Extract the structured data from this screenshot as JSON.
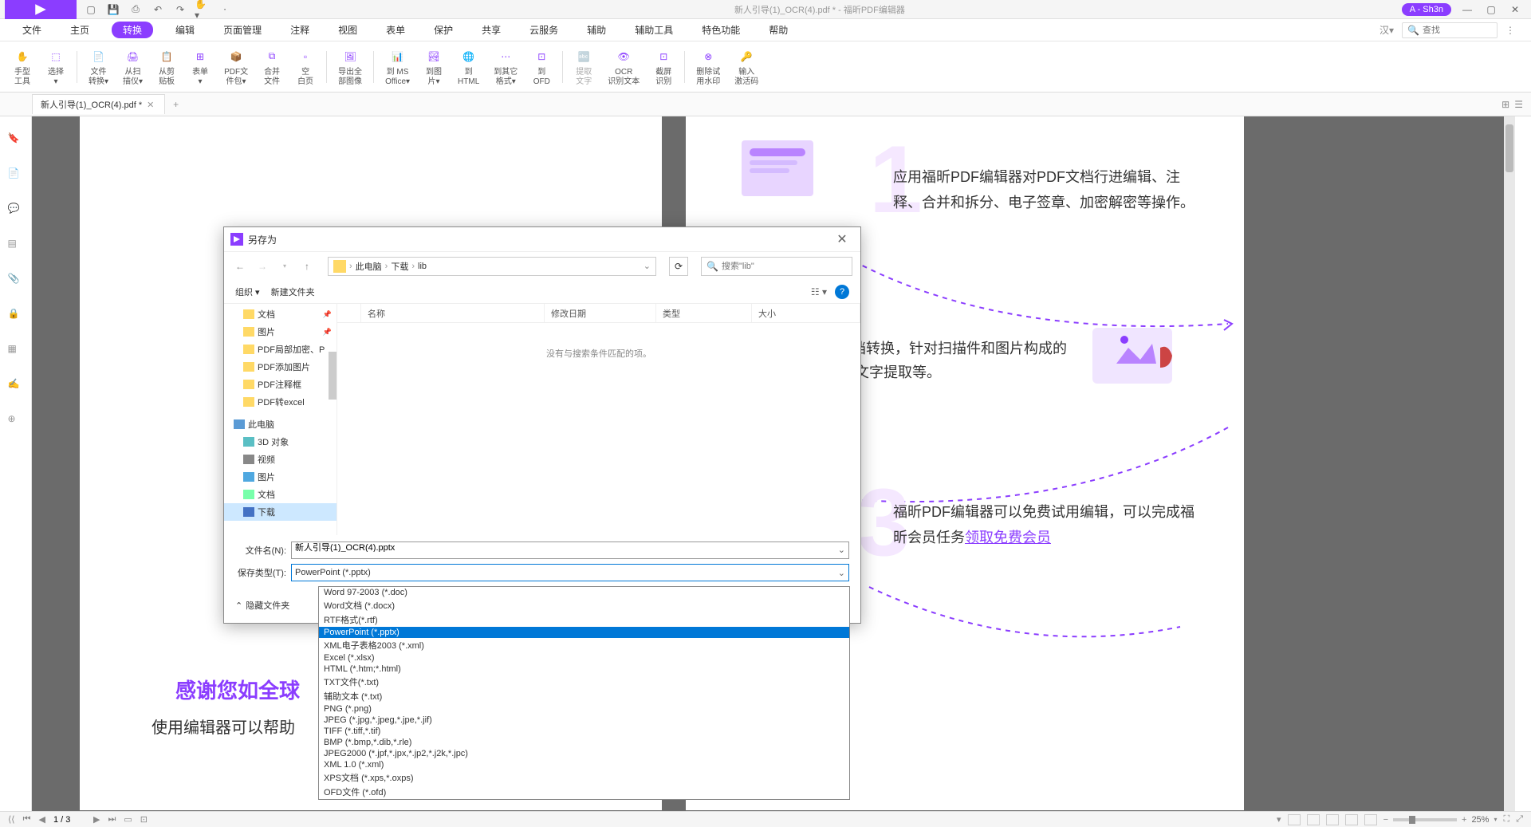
{
  "titlebar": {
    "title": "新人引导(1)_OCR(4).pdf * - 福昕PDF编辑器",
    "user": "A - Sh3n"
  },
  "menu": {
    "items": [
      "文件",
      "主页",
      "转换",
      "编辑",
      "页面管理",
      "注释",
      "视图",
      "表单",
      "保护",
      "共享",
      "云服务",
      "辅助",
      "辅助工具",
      "特色功能",
      "帮助"
    ],
    "active_index": 2,
    "search_placeholder": "查找"
  },
  "ribbon": {
    "items": [
      {
        "label": "手型\n工具",
        "icon": "hand"
      },
      {
        "label": "选择\n▾",
        "icon": "cursor"
      },
      {
        "label": "文件\n转换▾",
        "icon": "file"
      },
      {
        "label": "从扫\n描仪▾",
        "icon": "scanner"
      },
      {
        "label": "从剪\n贴板",
        "icon": "clipboard"
      },
      {
        "label": "表单\n▾",
        "icon": "form"
      },
      {
        "label": "PDF文\n件包▾",
        "icon": "package"
      },
      {
        "label": "合并\n文件",
        "icon": "merge"
      },
      {
        "label": "空\n白页",
        "icon": "blank"
      },
      {
        "label": "导出全\n部图像",
        "icon": "export"
      },
      {
        "label": "到 MS\nOffice▾",
        "icon": "office"
      },
      {
        "label": "到图\n片▾",
        "icon": "image"
      },
      {
        "label": "到\nHTML",
        "icon": "html"
      },
      {
        "label": "到其它\n格式▾",
        "icon": "other"
      },
      {
        "label": "到\nOFD",
        "icon": "ofd"
      },
      {
        "label": "提取\n文字",
        "icon": "text"
      },
      {
        "label": "OCR\n识别文本",
        "icon": "ocr"
      },
      {
        "label": "截屏\n识别",
        "icon": "screen"
      },
      {
        "label": "删除试\n用水印",
        "icon": "watermark"
      },
      {
        "label": "输入\n激活码",
        "icon": "key"
      }
    ]
  },
  "tabs": {
    "doc_name": "新人引导(1)_OCR(4).pdf *"
  },
  "page_content": {
    "para1": "应用福昕PDF编辑器对PDF文档行进编辑、注释、合并和拆分、电子签章、加密解密等操作。",
    "para2_a": "时可以完成文档转换，针对扫描件和图片构成的",
    "para2_b": "档，进行OCR文字提取等。",
    "para3_a": "福昕PDF编辑器可以免费试用编辑，可以完成福昕会员任务",
    "para3_link": "领取免费会员",
    "bottom1": "感谢您如全球",
    "bottom2": "使用编辑器可以帮助"
  },
  "dialog": {
    "title": "另存为",
    "breadcrumb": [
      "此电脑",
      "下载",
      "lib"
    ],
    "search_placeholder": "搜索\"lib\"",
    "organize": "组织 ▾",
    "new_folder": "新建文件夹",
    "columns": {
      "name": "名称",
      "date": "修改日期",
      "type": "类型",
      "size": "大小"
    },
    "empty_msg": "没有与搜索条件匹配的项。",
    "tree": [
      {
        "label": "文档",
        "icon": "folder",
        "pin": true
      },
      {
        "label": "图片",
        "icon": "folder",
        "pin": true
      },
      {
        "label": "PDF局部加密、P",
        "icon": "folder"
      },
      {
        "label": "PDF添加图片",
        "icon": "folder"
      },
      {
        "label": "PDF注释框",
        "icon": "folder"
      },
      {
        "label": "PDF转excel",
        "icon": "folder"
      },
      {
        "label": "此电脑",
        "icon": "pc"
      },
      {
        "label": "3D 对象",
        "icon": "3d"
      },
      {
        "label": "视频",
        "icon": "video"
      },
      {
        "label": "图片",
        "icon": "pic"
      },
      {
        "label": "文档",
        "icon": "doc"
      },
      {
        "label": "下载",
        "icon": "dl",
        "selected": true
      }
    ],
    "filename_label": "文件名(N):",
    "filename_value": "新人引导(1)_OCR(4).pptx",
    "filetype_label": "保存类型(T):",
    "filetype_value": "PowerPoint (*.pptx)",
    "hide_folders": "隐藏文件夹",
    "dropdown": [
      "Word 97-2003 (*.doc)",
      "Word文档 (*.docx)",
      "RTF格式(*.rtf)",
      "PowerPoint (*.pptx)",
      "XML电子表格2003 (*.xml)",
      "Excel (*.xlsx)",
      "HTML (*.htm;*.html)",
      "TXT文件(*.txt)",
      "辅助文本 (*.txt)",
      "PNG (*.png)",
      "JPEG (*.jpg,*.jpeg,*.jpe,*.jif)",
      "TIFF (*.tiff,*.tif)",
      "BMP (*.bmp,*.dib,*.rle)",
      "JPEG2000 (*.jpf,*.jpx,*.jp2,*.j2k,*.jpc)",
      "XML 1.0 (*.xml)",
      "XPS文档 (*.xps,*.oxps)",
      "OFD文件 (*.ofd)"
    ],
    "dropdown_selected": 3
  },
  "statusbar": {
    "page": "1 / 3",
    "zoom": "25%"
  }
}
